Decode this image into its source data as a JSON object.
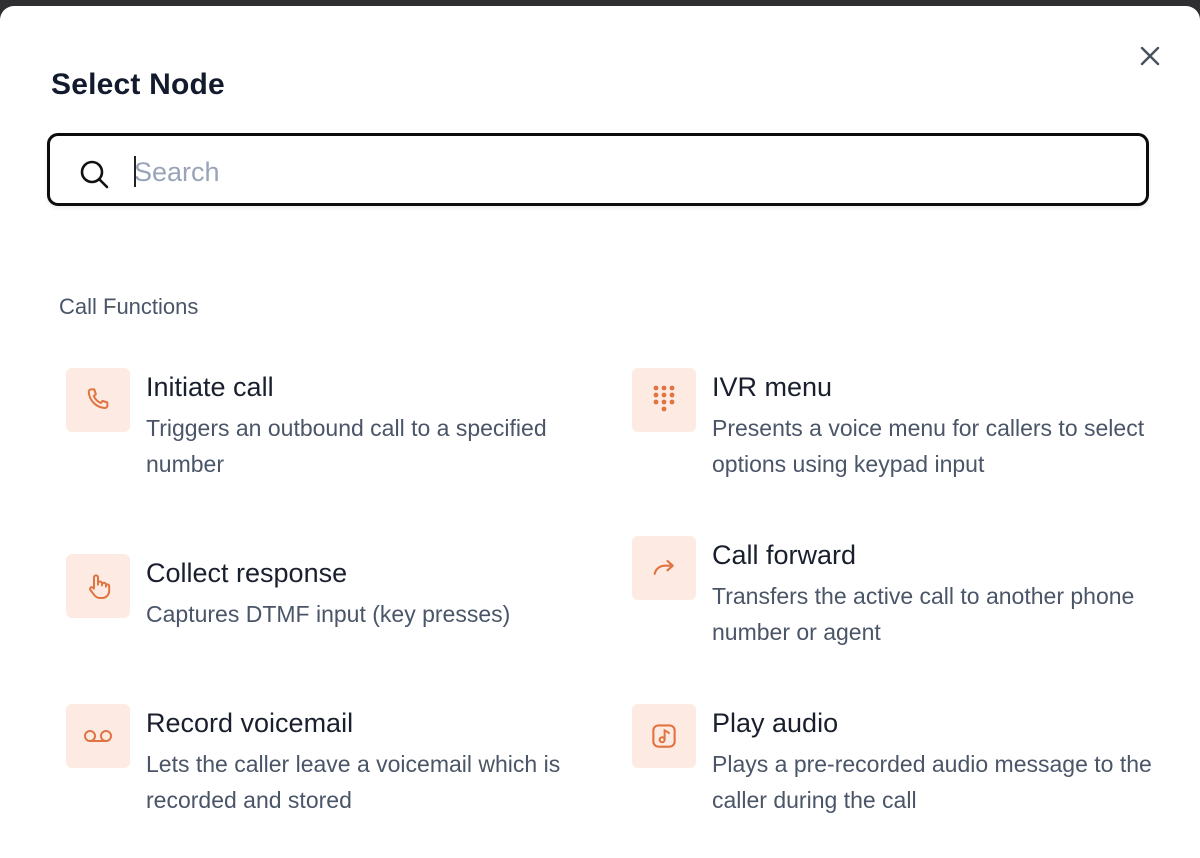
{
  "dialog": {
    "title": "Select Node",
    "close_icon": "close-icon"
  },
  "search": {
    "placeholder": "Search",
    "value": "",
    "icon": "search-icon"
  },
  "section": {
    "label": "Call Functions"
  },
  "colors": {
    "accent": "#e0733f",
    "icon_bg": "#fdebe3",
    "border_focus": "#0c0c0c"
  },
  "nodes": [
    {
      "icon": "phone-icon",
      "title": "Initiate call",
      "description": "Triggers an outbound call to a specified number"
    },
    {
      "icon": "keypad-icon",
      "title": "IVR menu",
      "description": "Presents a voice menu for callers to select options using keypad input"
    },
    {
      "icon": "hand-pointer-icon",
      "title": "Collect response",
      "description": "Captures DTMF input (key presses)"
    },
    {
      "icon": "forward-arrow-icon",
      "title": "Call forward",
      "description": "Transfers the active call to another phone number or agent"
    },
    {
      "icon": "voicemail-icon",
      "title": "Record voicemail",
      "description": "Lets the caller leave a voicemail which is recorded and stored"
    },
    {
      "icon": "music-note-icon",
      "title": "Play audio",
      "description": "Plays a pre-recorded audio message to the caller during the call"
    }
  ]
}
